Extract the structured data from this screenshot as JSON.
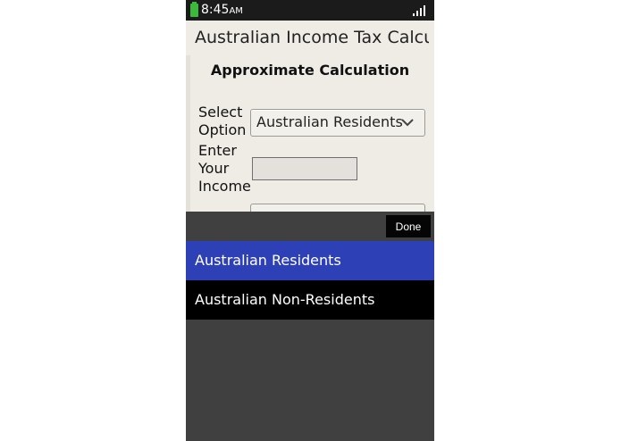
{
  "status_bar": {
    "time": "8:45",
    "ampm": "AM",
    "battery_icon": "battery-icon",
    "signal_icon": "signal-icon"
  },
  "app": {
    "title": "Australian Income Tax Calcu..."
  },
  "form": {
    "heading": "Approximate Calculation",
    "select_label_line1": "Select",
    "select_label_line2": "Option",
    "select_value": "Australian Residents",
    "income_label_line1": "Enter",
    "income_label_line2": "Your",
    "income_label_line3": "Income",
    "income_value": ""
  },
  "picker": {
    "done_label": "Done",
    "options": [
      {
        "label": "Australian Residents",
        "selected": true
      },
      {
        "label": "Australian Non-Residents",
        "selected": false
      }
    ]
  },
  "colors": {
    "status_bar_bg": "#1b1b1b",
    "battery": "#3cb83c",
    "app_bg": "#efece6",
    "picker_bg": "#404040",
    "selected_option_bg": "#2e40b5",
    "option_bg": "#000000"
  }
}
